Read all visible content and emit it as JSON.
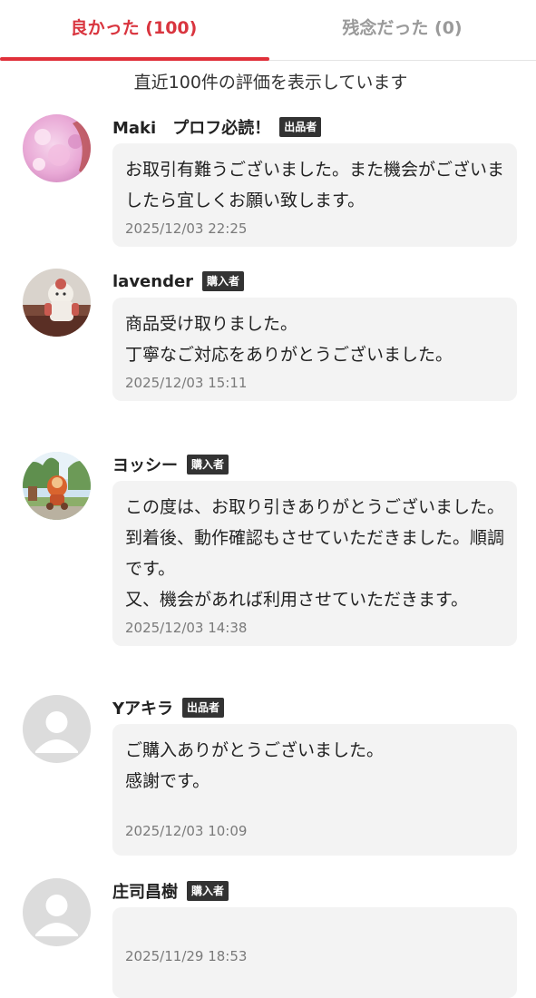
{
  "tabs": {
    "good_label": "良かった (100)",
    "bad_label": "残念だった (0)"
  },
  "notice": "直近100件の評価を表示しています",
  "reviews": [
    {
      "name": "Maki　プロフ必読！",
      "role": "出品者",
      "comment": "お取引有難うございました。また機会がございましたら宜しくお願い致します。",
      "timestamp": "2025/12/03 22:25",
      "avatar_icon": "pink-flower-photo"
    },
    {
      "name": "lavender",
      "role": "購入者",
      "comment": "商品受け取りました。\n丁寧なご対応をありがとうございました。",
      "timestamp": "2025/12/03 15:11",
      "avatar_icon": "figure-photo"
    },
    {
      "name": "ヨッシー",
      "role": "購入者",
      "comment": "この度は、お取り引きありがとうございました。到着後、動作確認もさせていただきました。順調です。\n又、機会があれば利用させていただきます。",
      "timestamp": "2025/12/03 14:38",
      "avatar_icon": "park-character-photo"
    },
    {
      "name": "Yアキラ",
      "role": "出品者",
      "comment": "ご購入ありがとうございました。\n感謝です。",
      "timestamp": "2025/12/03 10:09",
      "avatar_icon": "default-user-icon"
    },
    {
      "name": "庄司昌樹",
      "role": "購入者",
      "comment": "",
      "timestamp": "2025/11/29 18:53",
      "avatar_icon": "default-user-icon"
    }
  ],
  "colors": {
    "accent": "#e0303a",
    "badge": "#333333",
    "bubble": "#f3f3f3"
  }
}
